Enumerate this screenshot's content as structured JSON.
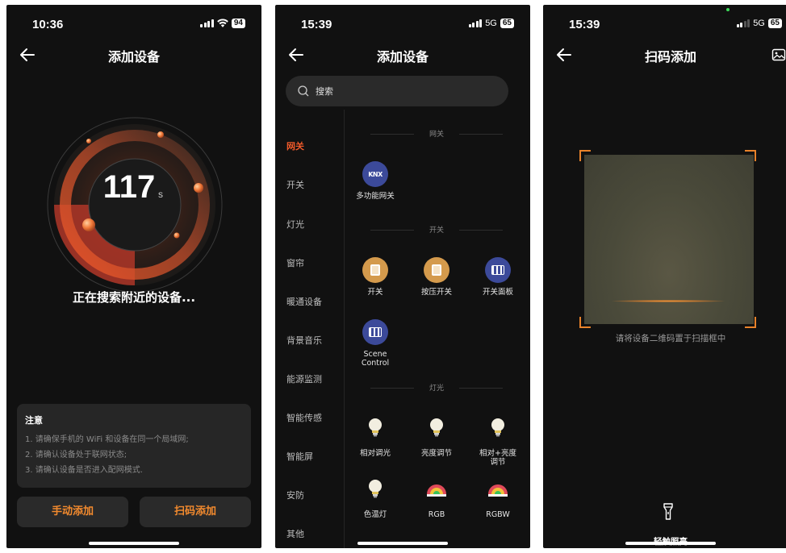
{
  "phone1": {
    "status": {
      "time": "10:36",
      "battery": "94"
    },
    "title": "添加设备",
    "countdown": {
      "value": "117",
      "unit": "s"
    },
    "searching_text": "正在搜索附近的设备...",
    "notes": {
      "heading": "注意",
      "lines": [
        "1. 请确保手机的 WiFi 和设备在同一个局域网;",
        "2. 请确认设备处于联网状态;",
        "3. 请确认设备是否进入配网模式."
      ]
    },
    "manual_add_label": "手动添加",
    "scan_add_label": "扫码添加",
    "colors": {
      "accent": "#f28a2e"
    }
  },
  "phone2": {
    "status": {
      "time": "15:39",
      "network": "5G",
      "battery": "65"
    },
    "title": "添加设备",
    "search_placeholder": "搜索",
    "categories": [
      "网关",
      "开关",
      "灯光",
      "窗帘",
      "暖通设备",
      "背景音乐",
      "能源监测",
      "智能传感",
      "智能屏",
      "安防",
      "其他"
    ],
    "sections": {
      "gateway": {
        "title": "网关",
        "devices": [
          {
            "label": "多功能网关",
            "icon": "knx-icon",
            "icon_text": "KNX"
          }
        ]
      },
      "switch": {
        "title": "开关",
        "devices": [
          {
            "label": "开关",
            "icon": "switch-icon"
          },
          {
            "label": "按压开关",
            "icon": "push-switch-icon"
          },
          {
            "label": "开关面板",
            "icon": "switch-panel-icon"
          },
          {
            "label": "Scene Control",
            "icon": "scene-control-icon"
          }
        ]
      },
      "light": {
        "title": "灯光",
        "devices": [
          {
            "label": "相对调光",
            "icon": "bulb-icon"
          },
          {
            "label": "亮度调节",
            "icon": "bulb-icon"
          },
          {
            "label": "相对+亮度调节",
            "icon": "bulb-icon"
          },
          {
            "label": "色温灯",
            "icon": "bulb-icon"
          },
          {
            "label": "RGB",
            "icon": "rgb-lamp-icon"
          },
          {
            "label": "RGBW",
            "icon": "rgbw-lamp-icon"
          }
        ]
      }
    },
    "colors": {
      "active_category": "#f05a2a",
      "device_blue": "#3c4a9a",
      "device_orange": "#d49a4c"
    }
  },
  "phone3": {
    "status": {
      "time": "15:39",
      "network": "5G",
      "battery": "65"
    },
    "title": "扫码添加",
    "scan_hint": "请将设备二维码置于扫描框中",
    "torch_label": "轻触照亮",
    "colors": {
      "frame": "#e8822a"
    }
  }
}
